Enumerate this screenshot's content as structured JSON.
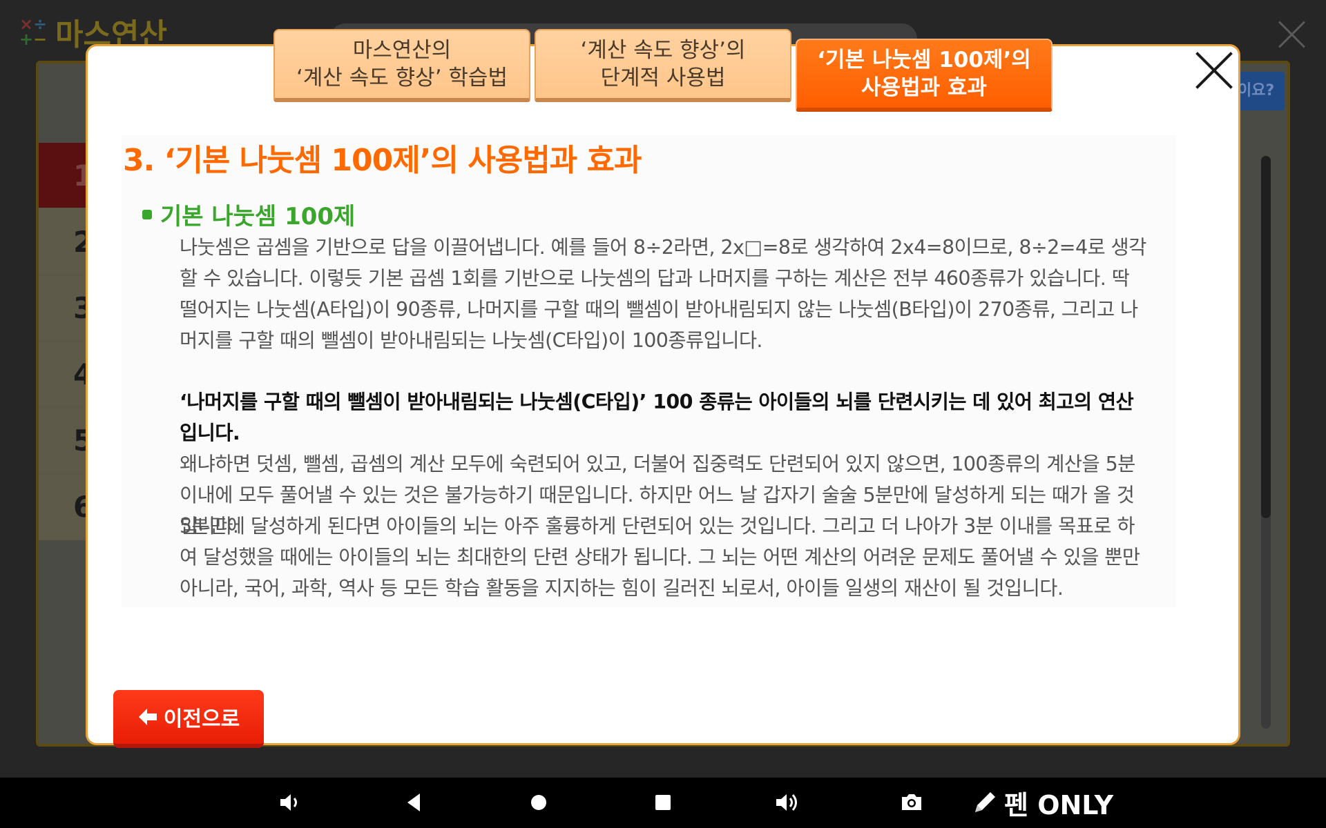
{
  "app": {
    "logo_text": "마스연산",
    "help_button": "이요?",
    "row_numbers": [
      "1",
      "2",
      "3",
      "4",
      "5",
      "6"
    ]
  },
  "tabs": [
    {
      "line1": "마스연산의",
      "line2": "‘계산 속도 향상’ 학습법",
      "active": false
    },
    {
      "line1": "‘계산 속도 향상’의",
      "line2": "단계적 사용법",
      "active": false
    },
    {
      "line1": "‘기본 나눗셈 100제’의",
      "line2": "사용법과 효과",
      "active": true
    }
  ],
  "content": {
    "section_title": "3. ‘기본 나눗셈 100제’의 사용법과 효과",
    "sub_title": "기본 나눗셈 100제",
    "paragraph1": "나눗셈은 곱셈을 기반으로 답을 이끌어냅니다. 예를 들어 8÷2라면, 2x□=8로 생각하여 2x4=8이므로, 8÷2=4로 생각할 수 있습니다. 이렇듯 기본 곱셈 1회를 기반으로 나눗셈의 답과 나머지를 구하는 계산은 전부 460종류가 있습니다. 딱 떨어지는 나눗셈(A타입)이 90종류, 나머지를 구할 때의 뺄셈이 받아내림되지 않는 나눗셈(B타입)이 270종류, 그리고 나머지를 구할 때의 뺄셈이 받아내림되는 나눗셈(C타입)이 100종류입니다.",
    "paragraph2_bold": "‘나머지를 구할 때의 뺄셈이 받아내림되는 나눗셈(C타입)’ 100 종류는 아이들의 뇌를 단련시키는 데 있어 최고의 연산입니다.",
    "paragraph2": "왜냐하면 덧셈, 뺄셈, 곱셈의 계산 모두에 숙련되어 있고, 더불어 집중력도 단련되어 있지 않으면, 100종류의 계산을 5분 이내에 모두 풀어낼 수 있는 것은 불가능하기 때문입니다. 하지만 어느 날 갑자기 술술 5분만에 달성하게 되는 때가 올 것입니다.",
    "paragraph3": "5분만에 달성하게 된다면 아이들의 뇌는 아주 훌륭하게 단련되어 있는 것입니다. 그리고 더 나아가 3분 이내를 목표로 하여 달성했을 때에는 아이들의 뇌는 최대한의 단련 상태가 됩니다. 그 뇌는 어떤 계산의 어려운 문제도 풀어낼 수 있을 뿐만 아니라, 국어, 과학, 역사 등 모든 학습 활동을 지지하는 힘이 길러진 뇌로서, 아이들 일생의 재산이 될 것입니다."
  },
  "prev_button": "이전으로",
  "navbar": {
    "pen_label": "펜 ONLY",
    "icons": [
      "volume-down-icon",
      "back-icon",
      "home-icon",
      "recent-apps-icon",
      "volume-up-icon",
      "camera-icon",
      "pen-icon"
    ]
  },
  "colors": {
    "accent_orange": "#ff6a00",
    "subtitle_green": "#3aa62c",
    "prev_button_red": "#e81e05",
    "tab_inactive": "#ffc58a"
  }
}
